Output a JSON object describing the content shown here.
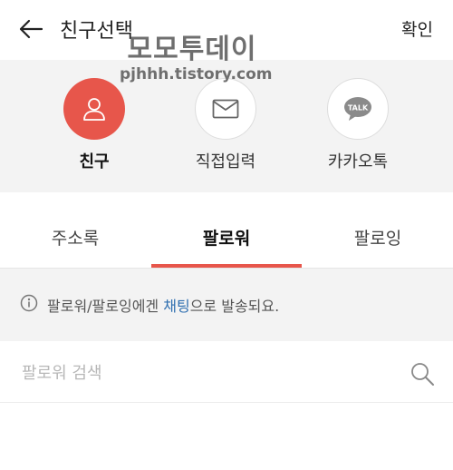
{
  "header": {
    "title": "친구선택",
    "confirm_label": "확인"
  },
  "watermark": {
    "title": "모모투데이",
    "url": "pjhhh.tistory.com"
  },
  "picker": {
    "items": [
      {
        "label": "친구",
        "icon": "person-icon",
        "active": true
      },
      {
        "label": "직접입력",
        "icon": "envelope-icon",
        "active": false
      },
      {
        "label": "카카오톡",
        "icon": "kakaotalk-icon",
        "icon_text": "TALK",
        "active": false
      }
    ]
  },
  "tabs": [
    {
      "label": "주소록",
      "active": false
    },
    {
      "label": "팔로워",
      "active": true
    },
    {
      "label": "팔로잉",
      "active": false
    }
  ],
  "notice": {
    "prefix": "팔로워/팔로잉에겐 ",
    "link": "채팅",
    "suffix": "으로 발송되요."
  },
  "search": {
    "placeholder": "팔로워 검색",
    "value": ""
  },
  "colors": {
    "accent": "#e7564b",
    "link": "#2f6fb0",
    "panel_bg": "#f3f3f3"
  }
}
